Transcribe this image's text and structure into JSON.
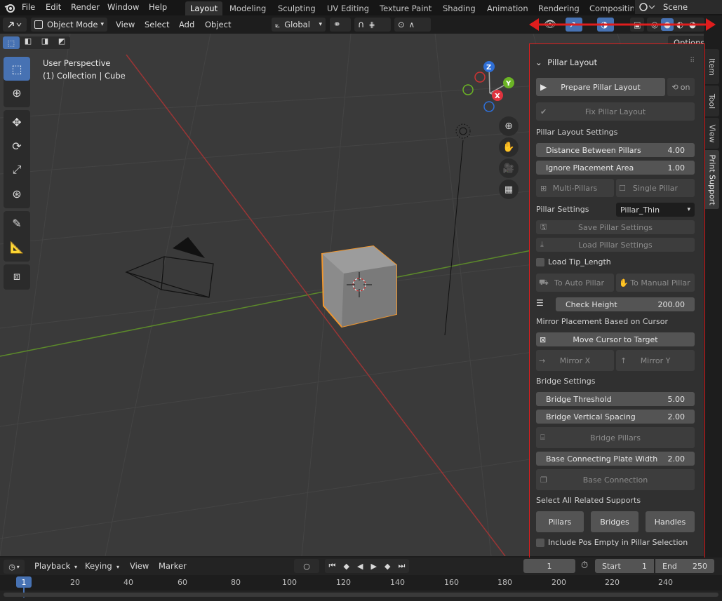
{
  "menubar": {
    "items": [
      "File",
      "Edit",
      "Render",
      "Window",
      "Help"
    ],
    "workspaces": [
      "Layout",
      "Modeling",
      "Sculpting",
      "UV Editing",
      "Texture Paint",
      "Shading",
      "Animation",
      "Rendering",
      "Compositin"
    ],
    "active_workspace": "Layout",
    "scene_label": "Scene"
  },
  "header": {
    "mode": "Object Mode",
    "menus": [
      "View",
      "Select",
      "Add",
      "Object"
    ],
    "transform_orientation": "Global",
    "options_label": "Options"
  },
  "viewport": {
    "perspective_label": "User Perspective",
    "collection_label": "(1) Collection | Cube",
    "gizmo_axes": [
      "Z",
      "Y",
      "X"
    ]
  },
  "sidebar_tabs": [
    "Item",
    "Tool",
    "View",
    "Print Support"
  ],
  "active_sidebar_tab": "Print Support",
  "panel": {
    "title": "Pillar Layout",
    "prepare_label": "Prepare Pillar Layout",
    "on_label": "on",
    "fix_label": "Fix Pillar Layout",
    "layout_settings_heading": "Pillar Layout Settings",
    "distance_label": "Distance Between Pillars",
    "distance_value": "4.00",
    "ignore_label": "Ignore Placement Area",
    "ignore_value": "1.00",
    "multi_label": "Multi-Pillars",
    "single_label": "Single Pillar",
    "pillar_settings_label": "Pillar Settings",
    "pillar_settings_value": "Pillar_Thin",
    "save_label": "Save Pillar Settings",
    "load_label": "Load Pillar Settings",
    "load_tip_label": "Load Tip_Length",
    "to_auto_label": "To Auto Pillar",
    "to_manual_label": "To Manual Pillar",
    "check_height_label": "Check Height",
    "check_height_value": "200.00",
    "mirror_heading": "Mirror Placement Based on Cursor",
    "move_cursor_label": "Move Cursor to Target",
    "mirror_x_label": "Mirror X",
    "mirror_y_label": "Mirror Y",
    "bridge_heading": "Bridge Settings",
    "bridge_threshold_label": "Bridge Threshold",
    "bridge_threshold_value": "5.00",
    "bridge_spacing_label": "Bridge Vertical Spacing",
    "bridge_spacing_value": "2.00",
    "bridge_pillars_label": "Bridge Pillars",
    "base_plate_label": "Base Connecting Plate Width",
    "base_plate_value": "2.00",
    "base_connection_label": "Base Connection",
    "select_heading": "Select All Related Supports",
    "pillars_label": "Pillars",
    "bridges_label": "Bridges",
    "handles_label": "Handles",
    "include_label": "Include Pos Empty in Pillar Selection"
  },
  "timeline": {
    "playback_label": "Playback",
    "keying_label": "Keying",
    "view_label": "View",
    "marker_label": "Marker",
    "current_frame": "1",
    "start_label": "Start",
    "start_value": "1",
    "end_label": "End",
    "end_value": "250",
    "ruler": [
      "1",
      "20",
      "40",
      "60",
      "80",
      "100",
      "120",
      "140",
      "160",
      "180",
      "200",
      "220",
      "240"
    ]
  },
  "colors": {
    "accent_blue": "#4772b3",
    "highlight_red": "#e01d1d",
    "selection_orange": "#f0962e"
  }
}
